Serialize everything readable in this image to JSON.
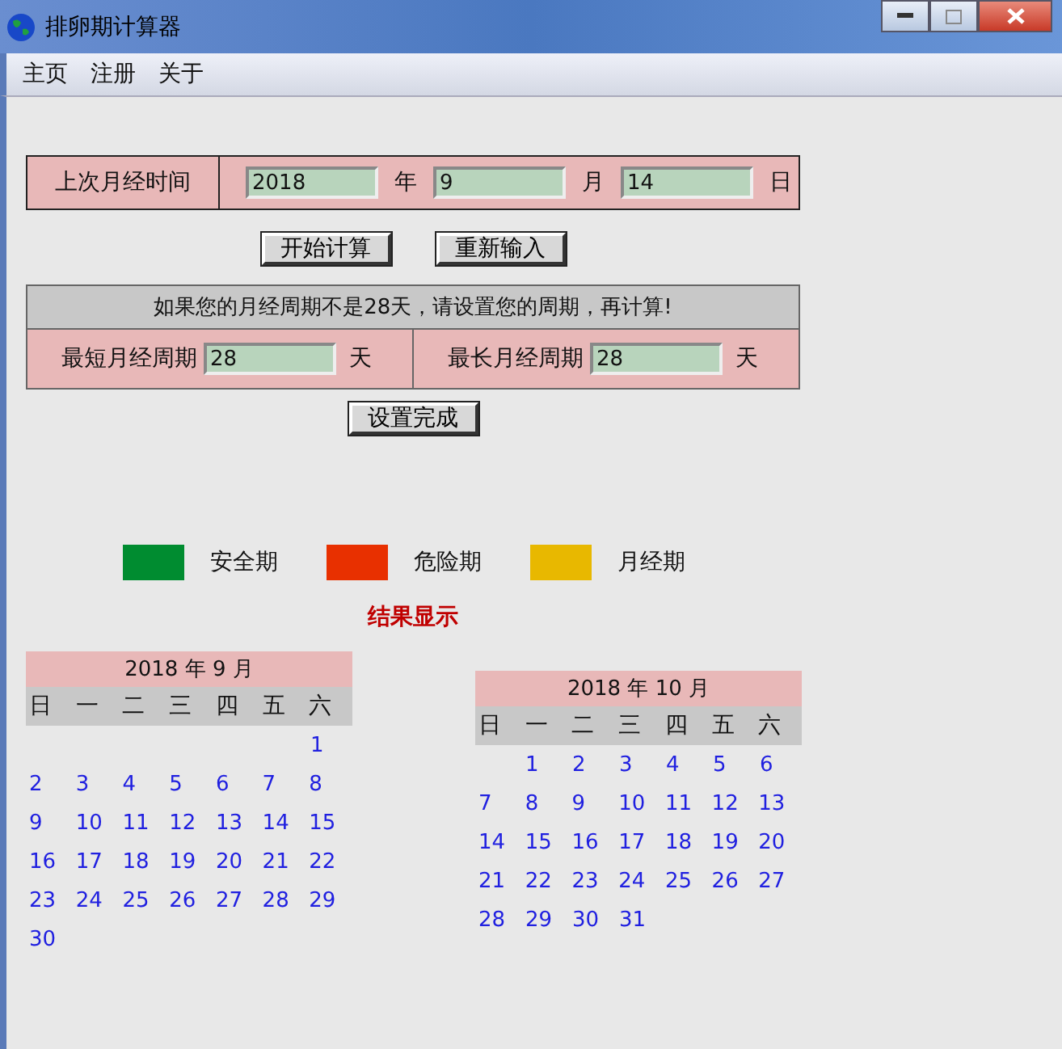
{
  "window": {
    "title": "排卵期计算器"
  },
  "menu": [
    "主页",
    "注册",
    "关于"
  ],
  "last_period": {
    "label": "上次月经时间",
    "year": "2018",
    "year_unit": "年",
    "month": "9",
    "month_unit": "月",
    "day": "14",
    "day_unit": "日"
  },
  "buttons": [
    "开始计算",
    "重新输入"
  ],
  "cycle": {
    "notice": "如果您的月经周期不是28天，请设置您的周期，再计算!",
    "shortest_label": "最短月经周期",
    "shortest": "28",
    "shortest_unit": "天",
    "longest_label": "最长月经周期",
    "longest": "28",
    "longest_unit": "天",
    "done_button": "设置完成"
  },
  "legend": [
    {
      "label": "安全期",
      "color": "#008c30"
    },
    {
      "label": "危险期",
      "color": "#e83000"
    },
    {
      "label": "月经期",
      "color": "#e8b800"
    }
  ],
  "result_title": "结果显示",
  "calendars": [
    {
      "title": "2018 年 9 月",
      "weekdays": [
        "日",
        "一",
        "二",
        "三",
        "四",
        "五",
        "六"
      ],
      "weeks": [
        {
          "kind": "end",
          "days": [
            "1"
          ]
        },
        {
          "kind": "full",
          "days": [
            "2",
            "3",
            "4",
            "5",
            "6",
            "7",
            "8"
          ]
        },
        {
          "kind": "full",
          "days": [
            "9",
            "10",
            "11",
            "12",
            "13",
            "14",
            "15"
          ]
        },
        {
          "kind": "full",
          "days": [
            "16",
            "17",
            "18",
            "19",
            "20",
            "21",
            "22"
          ]
        },
        {
          "kind": "full",
          "days": [
            "23",
            "24",
            "25",
            "26",
            "27",
            "28",
            "29"
          ]
        },
        {
          "kind": "start",
          "days": [
            "30"
          ]
        }
      ]
    },
    {
      "title": "2018 年 10 月",
      "weekdays": [
        "日",
        "一",
        "二",
        "三",
        "四",
        "五",
        "六"
      ],
      "weeks": [
        {
          "kind": "end",
          "days": [
            "1",
            "2",
            "3",
            "4",
            "5",
            "6"
          ]
        },
        {
          "kind": "full",
          "days": [
            "7",
            "8",
            "9",
            "10",
            "11",
            "12",
            "13"
          ]
        },
        {
          "kind": "full",
          "days": [
            "14",
            "15",
            "16",
            "17",
            "18",
            "19",
            "20"
          ]
        },
        {
          "kind": "full",
          "days": [
            "21",
            "22",
            "23",
            "24",
            "25",
            "26",
            "27"
          ]
        },
        {
          "kind": "start",
          "days": [
            "28",
            "29",
            "30",
            "31"
          ]
        }
      ]
    }
  ]
}
